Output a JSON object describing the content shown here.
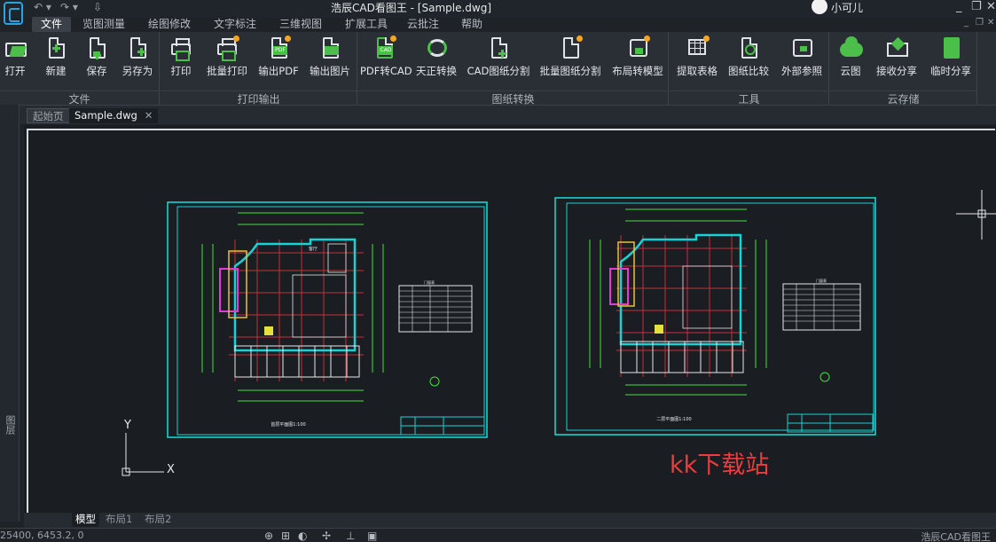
{
  "window": {
    "title": "浩辰CAD看图王 - [Sample.dwg]",
    "user_name": "小可儿",
    "controls": [
      "_",
      "❐",
      "✕"
    ]
  },
  "quick_access": [
    "↶ ▾",
    "↷ ▾",
    "⇩"
  ],
  "menu": {
    "tabs": [
      {
        "label": "文件",
        "active": true
      },
      {
        "label": "览图测量"
      },
      {
        "label": "绘图修改"
      },
      {
        "label": "文字标注"
      },
      {
        "label": "三维视图"
      },
      {
        "label": "扩展工具"
      },
      {
        "label": "云批注"
      },
      {
        "label": "帮助"
      }
    ]
  },
  "ribbon": {
    "groups": [
      {
        "label": "文件",
        "buttons": [
          {
            "label": "打开",
            "icon": "open-folder-icon"
          },
          {
            "label": "新建",
            "icon": "new-file-icon"
          },
          {
            "label": "保存",
            "icon": "save-icon"
          },
          {
            "label": "另存为",
            "icon": "save-as-icon"
          }
        ]
      },
      {
        "label": "打印输出",
        "buttons": [
          {
            "label": "打印",
            "icon": "print-icon"
          },
          {
            "label": "批量打印",
            "icon": "batch-print-icon"
          },
          {
            "label": "输出PDF",
            "icon": "export-pdf-icon"
          },
          {
            "label": "输出图片",
            "icon": "export-image-icon"
          }
        ]
      },
      {
        "label": "图纸转换",
        "buttons": [
          {
            "label": "PDF转CAD",
            "icon": "pdf-to-cad-icon"
          },
          {
            "label": "天正转换",
            "icon": "tangent-convert-icon"
          },
          {
            "label": "CAD图纸分割",
            "icon": "split-drawing-icon"
          },
          {
            "label": "批量图纸分割",
            "icon": "batch-split-icon"
          },
          {
            "label": "布局转模型",
            "icon": "layout-to-model-icon"
          }
        ]
      },
      {
        "label": "工具",
        "buttons": [
          {
            "label": "提取表格",
            "icon": "extract-table-icon"
          },
          {
            "label": "图纸比较",
            "icon": "compare-icon"
          },
          {
            "label": "外部参照",
            "icon": "xref-icon"
          }
        ]
      },
      {
        "label": "云存储",
        "buttons": [
          {
            "label": "云图",
            "icon": "cloud-icon"
          },
          {
            "label": "接收分享",
            "icon": "receive-share-icon"
          },
          {
            "label": "临时分享",
            "icon": "temp-share-icon"
          }
        ]
      }
    ]
  },
  "doc_tabs": {
    "home": "起始页",
    "file": "Sample.dwg",
    "close": "✕"
  },
  "side_panel": {
    "label": "图层"
  },
  "drawing": {
    "sheet1_title": "首层平面图1:100",
    "sheet2_title": "二层平面图1:100",
    "axis_y": "Y",
    "axis_x": "X",
    "watermark": "kk下载站",
    "table_header": "门窗表"
  },
  "layout_tabs": {
    "model": "模型",
    "layout1": "布局1",
    "layout2": "布局2"
  },
  "status": {
    "coords": "25400, 6453.2, 0",
    "icons": [
      "⊕",
      "⊞",
      "◐",
      "✢",
      "⊥",
      "▣"
    ],
    "brand": "浩辰CAD看图王"
  },
  "colors": {
    "accent": "#2aa3e0",
    "green": "#4cbf4a",
    "cyan": "#17d3d6",
    "red": "#ea3d3d"
  }
}
